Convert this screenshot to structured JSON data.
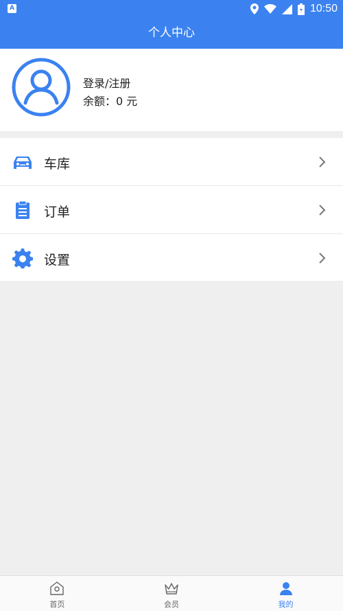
{
  "status_bar": {
    "time": "10:50",
    "app_badge": "A"
  },
  "header": {
    "title": "个人中心"
  },
  "profile": {
    "login_label": "登录/注册",
    "balance_label": "余额：0 元"
  },
  "menu": {
    "items": [
      {
        "label": "车库",
        "icon": "car-icon"
      },
      {
        "label": "订单",
        "icon": "clipboard-icon"
      },
      {
        "label": "设置",
        "icon": "gear-icon"
      }
    ]
  },
  "bottom_nav": {
    "items": [
      {
        "label": "首页",
        "icon": "home-icon"
      },
      {
        "label": "会员",
        "icon": "crown-icon"
      },
      {
        "label": "我的",
        "icon": "person-icon",
        "active": true
      }
    ]
  },
  "colors": {
    "accent": "#3b82f0",
    "background": "#efefef"
  }
}
